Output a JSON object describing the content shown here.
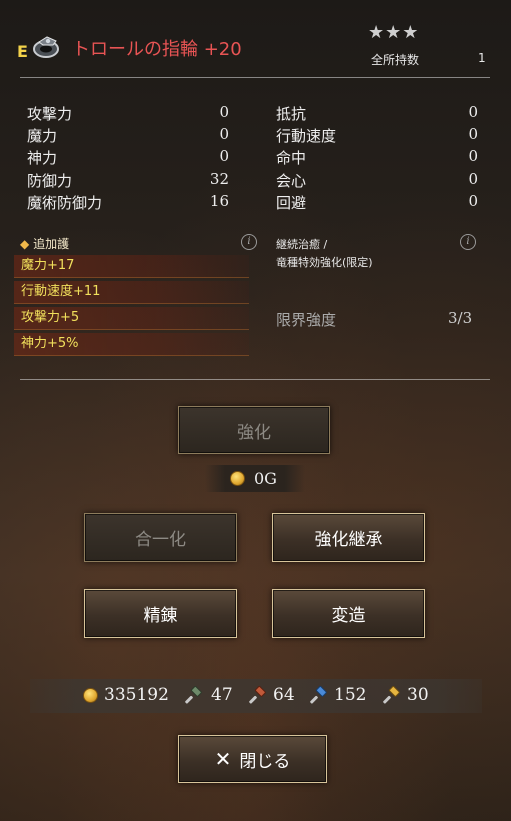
{
  "item": {
    "equipped_badge": "E",
    "ring_icon": "ring-icon",
    "name": "トロールの指輪 +20",
    "stars": "★★★",
    "owned_label": "全所持数",
    "owned_count": "1"
  },
  "stats_left": [
    {
      "label": "攻撃力",
      "value": "0"
    },
    {
      "label": "魔力",
      "value": "0"
    },
    {
      "label": "神力",
      "value": "0"
    },
    {
      "label": "防御力",
      "value": "32"
    },
    {
      "label": "魔術防御力",
      "value": "16"
    }
  ],
  "stats_right": [
    {
      "label": "抵抗",
      "value": "0"
    },
    {
      "label": "行動速度",
      "value": "0"
    },
    {
      "label": "命中",
      "value": "0"
    },
    {
      "label": "会心",
      "value": "0"
    },
    {
      "label": "回避",
      "value": "0"
    }
  ],
  "bonus": {
    "header_marker": "◆",
    "header": "追加護",
    "info_glyph": "i",
    "rows": [
      "魔力+17",
      "行動速度+11",
      "攻撃力+5",
      "神力+5%"
    ]
  },
  "effect": {
    "line1": "継続治癒 /",
    "line2": "竜種特効強化(限定)"
  },
  "limit": {
    "label": "限界強度",
    "value": "3/3"
  },
  "actions": {
    "enhance": "強化",
    "enhance_cost": "0G",
    "merge": "合一化",
    "inherit": "強化継承",
    "refine": "精錬",
    "transform": "変造",
    "close_x": "✕",
    "close": "閉じる"
  },
  "resources": {
    "gold": "335192",
    "green_hammer": "47",
    "red_hammer": "64",
    "blue_hammer": "152",
    "gold_hammer": "30"
  },
  "colors": {
    "title_red": "#e85454",
    "bonus_yellow": "#f1e05c",
    "badge_yellow": "#f3d24a",
    "button_border": "#d7c49a"
  }
}
